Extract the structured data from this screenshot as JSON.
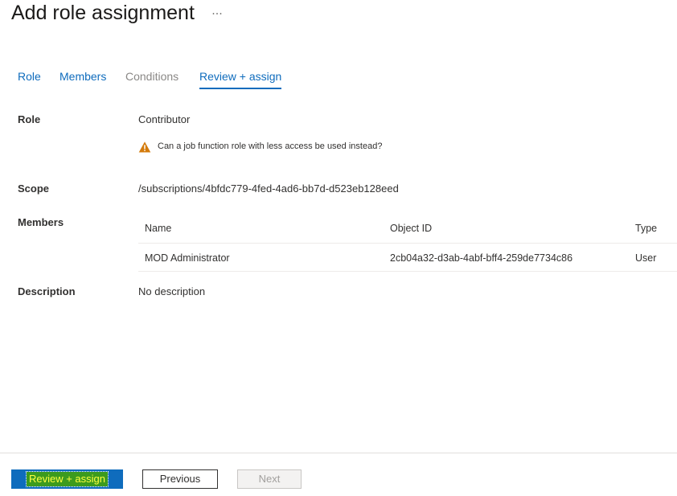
{
  "header": {
    "title": "Add role assignment",
    "more_icon": "ellipsis-icon"
  },
  "tabs": [
    {
      "label": "Role",
      "state": "link"
    },
    {
      "label": "Members",
      "state": "link"
    },
    {
      "label": "Conditions",
      "state": "disabled"
    },
    {
      "label": "Review + assign",
      "state": "active"
    }
  ],
  "details": {
    "role_label": "Role",
    "role_value": "Contributor",
    "warning_text": "Can a job function role with less access be used instead?",
    "warning_icon": "warning-triangle-icon",
    "scope_label": "Scope",
    "scope_value": "/subscriptions/4bfdc779-4fed-4ad6-bb7d-d523eb128eed",
    "members_label": "Members",
    "description_label": "Description",
    "description_value": "No description"
  },
  "members_table": {
    "columns": [
      "Name",
      "Object ID",
      "Type"
    ],
    "rows": [
      {
        "name": "MOD Administrator",
        "object_id": "2cb04a32-d3ab-4abf-bff4-259de7734c86",
        "type": "User"
      }
    ]
  },
  "footer": {
    "review_assign_label": "Review + assign",
    "previous_label": "Previous",
    "next_label": "Next"
  },
  "colors": {
    "accent": "#0f6cbd",
    "warning": "#d47b0b",
    "text": "#323130",
    "disabled_text": "#8a8886"
  }
}
